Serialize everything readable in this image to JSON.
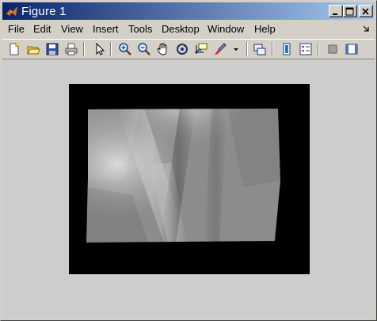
{
  "window": {
    "title": "Figure 1"
  },
  "menu": {
    "items": [
      "File",
      "Edit",
      "View",
      "Insert",
      "Tools",
      "Desktop",
      "Window",
      "Help"
    ]
  },
  "toolbar": {
    "tools": [
      "new-figure-icon",
      "open-file-icon",
      "save-icon",
      "print-icon",
      "edit-plot-arrow-icon",
      "zoom-in-icon",
      "zoom-out-icon",
      "pan-hand-icon",
      "rotate-3d-icon",
      "data-cursor-icon",
      "brush-icon",
      "brush-dropdown-icon",
      "link-plot-icon",
      "colorbar-icon",
      "legend-icon",
      "hide-plot-tools-icon",
      "show-plot-tools-icon"
    ]
  },
  "colors": {
    "title_gradient_start": "#0a246a",
    "title_gradient_end": "#a6caf0",
    "axes_background": "#000000",
    "figure_background": "#cdcdcd"
  }
}
